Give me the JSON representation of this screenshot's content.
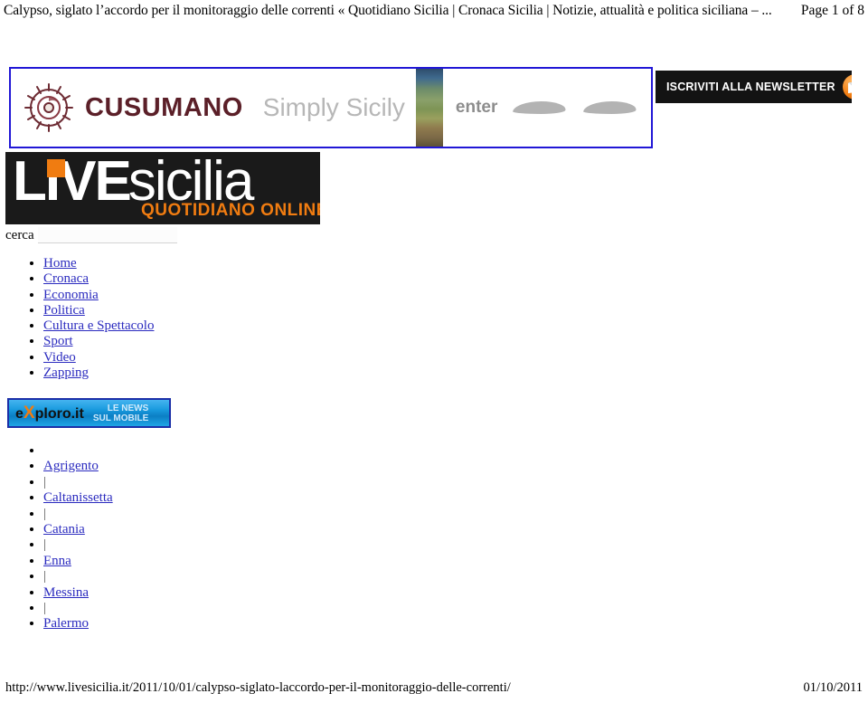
{
  "page_header": {
    "doc_title": "Calypso, siglato l’accordo per il monitoraggio delle correnti « Quotidiano Sicilia | Cronaca Sicilia | Notizie, attualità e politica siciliana – ...",
    "page_number": "Page 1 of 8"
  },
  "ads": {
    "cusumano": {
      "logo_icon": "sun-spiral-logo",
      "brand": "CUSUMANO",
      "tagline": "Simply Sicily",
      "cta": "enter",
      "photo_icon": "vineyard-photo-strip",
      "decor_icon": "wing-ornament"
    },
    "newsletter": {
      "label": "ISCRIVITI ALLA NEWSLETTER",
      "icon": "envelope-icon",
      "icon_color": "#f07c11",
      "background": "#131313"
    },
    "exploro": {
      "brand_prefix": "e",
      "brand_x": "X",
      "brand_suffix": "ploro.it",
      "tagline_line1": "LE NEWS",
      "tagline_line2": "SUL MOBILE",
      "accent": "#f07c11",
      "background": "#199ade"
    }
  },
  "masthead": {
    "live": "LIVE",
    "sicilia": "sicilia",
    "subtitle": "QUOTIDIANO ONLINE",
    "accent": "#f07c11",
    "background": "#1a1a1a"
  },
  "search": {
    "label": "cerca",
    "value": "",
    "placeholder": ""
  },
  "main_nav": {
    "items": [
      {
        "label": "Home"
      },
      {
        "label": "Cronaca"
      },
      {
        "label": "Economia"
      },
      {
        "label": "Politica"
      },
      {
        "label": "Cultura e Spettacolo"
      },
      {
        "label": "Sport"
      },
      {
        "label": "Video"
      },
      {
        "label": "Zapping"
      }
    ]
  },
  "city_nav": {
    "separator": "|",
    "items": [
      {
        "type": "empty",
        "label": ""
      },
      {
        "type": "link",
        "label": "Agrigento"
      },
      {
        "type": "separator",
        "label": "|"
      },
      {
        "type": "link",
        "label": "Caltanissetta"
      },
      {
        "type": "separator",
        "label": "|"
      },
      {
        "type": "link",
        "label": "Catania"
      },
      {
        "type": "separator",
        "label": "|"
      },
      {
        "type": "link",
        "label": "Enna"
      },
      {
        "type": "separator",
        "label": "|"
      },
      {
        "type": "link",
        "label": "Messina"
      },
      {
        "type": "separator",
        "label": "|"
      },
      {
        "type": "link",
        "label": "Palermo"
      }
    ]
  },
  "page_footer": {
    "url": "http://www.livesicilia.it/2011/10/01/calypso-siglato-laccordo-per-il-monitoraggio-delle-correnti/",
    "date": "01/10/2011"
  },
  "link_color": "#2b2bbf"
}
